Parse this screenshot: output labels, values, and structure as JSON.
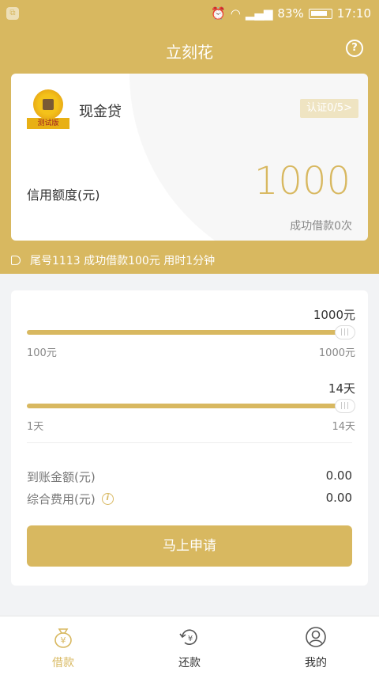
{
  "status_bar": {
    "battery": "83%",
    "time": "17:10"
  },
  "header": {
    "title": "立刻花"
  },
  "card": {
    "product_name": "现金贷",
    "logo_tag": "测试版",
    "verify_label": "认证0/5>",
    "credit_label": "信用额度(元)",
    "credit_value": "1000",
    "success_count": "成功借款0次"
  },
  "notice": {
    "text": "尾号1113 成功借款100元 用时1分钟"
  },
  "amount_slider": {
    "value_label": "1000元",
    "min_label": "100元",
    "max_label": "1000元",
    "fraction": 1.0
  },
  "days_slider": {
    "value_label": "14天",
    "min_label": "1天",
    "max_label": "14天",
    "fraction": 1.0
  },
  "summary": {
    "arrival_label": "到账金额(元)",
    "arrival_value": "0.00",
    "fee_label": "综合费用(元)",
    "fee_value": "0.00"
  },
  "apply_button": {
    "label": "马上申请"
  },
  "tabs": [
    {
      "label": "借款",
      "icon": "money-bag-icon",
      "active": true
    },
    {
      "label": "还款",
      "icon": "repay-icon",
      "active": false
    },
    {
      "label": "我的",
      "icon": "user-icon",
      "active": false
    }
  ],
  "colors": {
    "accent": "#d8b860",
    "background": "#f2f3f5"
  }
}
